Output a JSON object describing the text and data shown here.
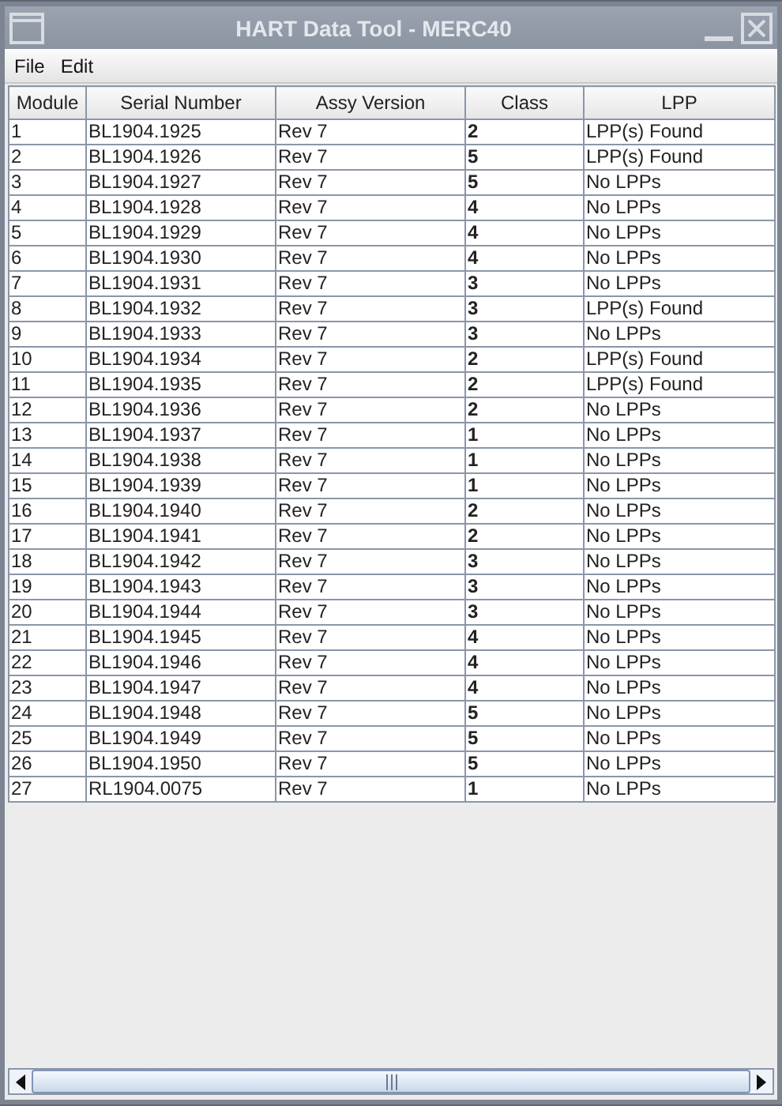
{
  "window": {
    "title": "HART Data Tool - MERC40"
  },
  "menu": [
    "File",
    "Edit"
  ],
  "table": {
    "columns": [
      "Module",
      "Serial Number",
      "Assy Version",
      "Class",
      "LPP"
    ],
    "rows": [
      [
        "1",
        "BL1904.1925",
        "Rev 7",
        "2",
        "LPP(s) Found"
      ],
      [
        "2",
        "BL1904.1926",
        "Rev 7",
        "5",
        "LPP(s) Found"
      ],
      [
        "3",
        "BL1904.1927",
        "Rev 7",
        "5",
        "No LPPs"
      ],
      [
        "4",
        "BL1904.1928",
        "Rev 7",
        "4",
        "No LPPs"
      ],
      [
        "5",
        "BL1904.1929",
        "Rev 7",
        "4",
        "No LPPs"
      ],
      [
        "6",
        "BL1904.1930",
        "Rev 7",
        "4",
        "No LPPs"
      ],
      [
        "7",
        "BL1904.1931",
        "Rev 7",
        "3",
        "No LPPs"
      ],
      [
        "8",
        "BL1904.1932",
        "Rev 7",
        "3",
        "LPP(s) Found"
      ],
      [
        "9",
        "BL1904.1933",
        "Rev 7",
        "3",
        "No LPPs"
      ],
      [
        "10",
        "BL1904.1934",
        "Rev 7",
        "2",
        "LPP(s) Found"
      ],
      [
        "11",
        "BL1904.1935",
        "Rev 7",
        "2",
        "LPP(s) Found"
      ],
      [
        "12",
        "BL1904.1936",
        "Rev 7",
        "2",
        "No LPPs"
      ],
      [
        "13",
        "BL1904.1937",
        "Rev 7",
        "1",
        "No LPPs"
      ],
      [
        "14",
        "BL1904.1938",
        "Rev 7",
        "1",
        "No LPPs"
      ],
      [
        "15",
        "BL1904.1939",
        "Rev 7",
        "1",
        "No LPPs"
      ],
      [
        "16",
        "BL1904.1940",
        "Rev 7",
        "2",
        "No LPPs"
      ],
      [
        "17",
        "BL1904.1941",
        "Rev 7",
        "2",
        "No LPPs"
      ],
      [
        "18",
        "BL1904.1942",
        "Rev 7",
        "3",
        "No LPPs"
      ],
      [
        "19",
        "BL1904.1943",
        "Rev 7",
        "3",
        "No LPPs"
      ],
      [
        "20",
        "BL1904.1944",
        "Rev 7",
        "3",
        "No LPPs"
      ],
      [
        "21",
        "BL1904.1945",
        "Rev 7",
        "4",
        "No LPPs"
      ],
      [
        "22",
        "BL1904.1946",
        "Rev 7",
        "4",
        "No LPPs"
      ],
      [
        "23",
        "BL1904.1947",
        "Rev 7",
        "4",
        "No LPPs"
      ],
      [
        "24",
        "BL1904.1948",
        "Rev 7",
        "5",
        "No LPPs"
      ],
      [
        "25",
        "BL1904.1949",
        "Rev 7",
        "5",
        "No LPPs"
      ],
      [
        "26",
        "BL1904.1950",
        "Rev 7",
        "5",
        "No LPPs"
      ],
      [
        "27",
        "RL1904.0075",
        "Rev 7",
        "1",
        "No LPPs"
      ]
    ]
  }
}
